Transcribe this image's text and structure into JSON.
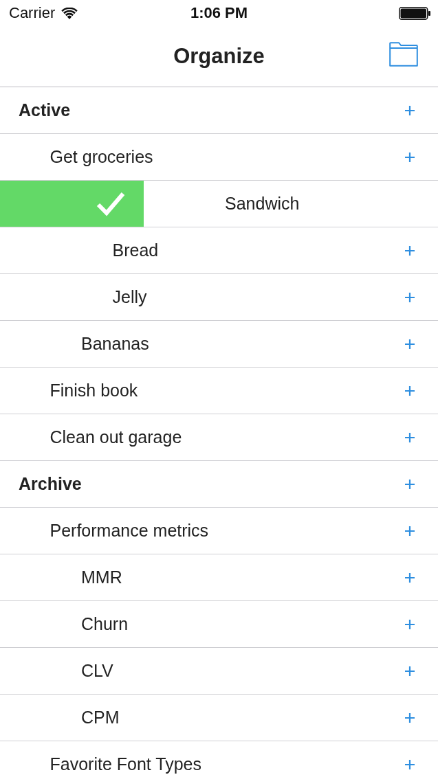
{
  "status_bar": {
    "carrier": "Carrier",
    "time": "1:06 PM"
  },
  "nav": {
    "title": "Organize"
  },
  "sections": [
    {
      "title": "Active",
      "children": [
        {
          "label": "Get groceries",
          "swiped": false,
          "children": [
            {
              "label": "Sandwich",
              "swiped": true,
              "children": [
                {
                  "label": "Bread",
                  "swiped": false
                },
                {
                  "label": "Jelly",
                  "swiped": false
                }
              ]
            },
            {
              "label": "Bananas",
              "swiped": false
            }
          ]
        },
        {
          "label": "Finish book",
          "swiped": false
        },
        {
          "label": "Clean out garage",
          "swiped": false
        }
      ]
    },
    {
      "title": "Archive",
      "children": [
        {
          "label": "Performance metrics",
          "swiped": false,
          "children": [
            {
              "label": "MMR",
              "swiped": false
            },
            {
              "label": "Churn",
              "swiped": false
            },
            {
              "label": "CLV",
              "swiped": false
            },
            {
              "label": "CPM",
              "swiped": false
            }
          ]
        },
        {
          "label": "Favorite Font Types",
          "swiped": false
        }
      ]
    }
  ]
}
